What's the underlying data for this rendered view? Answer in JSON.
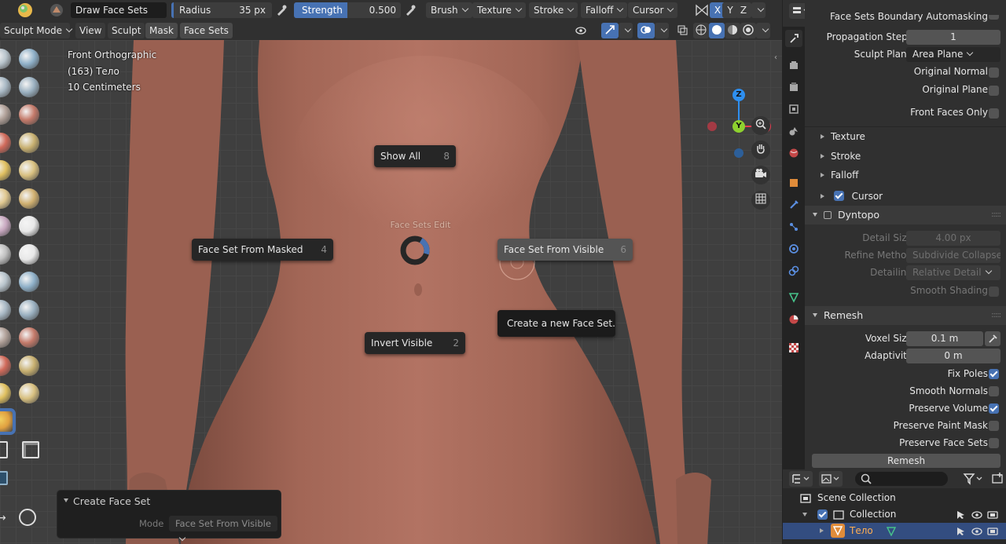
{
  "header": {
    "brush_name": "Draw Face Sets",
    "radius_label": "Radius",
    "radius_value": "35 px",
    "strength_label": "Strength",
    "strength_value": "0.500",
    "menus": [
      "Brush",
      "Texture",
      "Stroke",
      "Falloff",
      "Cursor"
    ],
    "symmetry_axes": [
      "X",
      "Y",
      "Z"
    ]
  },
  "mode_bar": {
    "mode": "Sculpt Mode",
    "menus": [
      "View",
      "Sculpt",
      "Mask",
      "Face Sets"
    ]
  },
  "viewport": {
    "view_name": "Front Orthographic",
    "object_info": "(163) Тело",
    "scale_info": "10 Centimeters",
    "gizmo_axes": [
      "Z",
      "Y",
      "X"
    ]
  },
  "pie_menu": {
    "title": "Face Sets Edit",
    "items": [
      {
        "label": "Show All",
        "key": "8"
      },
      {
        "label": "Face Set From Masked",
        "key": "4"
      },
      {
        "label": "Face Set From Visible",
        "key": "6"
      },
      {
        "label": "Invert Visible",
        "key": "2"
      }
    ],
    "tooltip": "Create a new Face Set."
  },
  "operator_panel": {
    "title": "Create Face Set",
    "mode_label": "Mode",
    "mode_value": "Face Set From Visible"
  },
  "properties": {
    "top_cut_label": "Face Sets Boundary Automasking",
    "propagation_steps_label": "Propagation Steps",
    "propagation_steps_value": "1",
    "sculpt_plane_label": "Sculpt Plane",
    "sculpt_plane_value": "Area Plane",
    "original_normal_label": "Original Normal",
    "original_plane_label": "Original Plane",
    "front_faces_only_label": "Front Faces Only",
    "subpanels": [
      "Texture",
      "Stroke",
      "Falloff",
      "Cursor"
    ],
    "dyntopo": {
      "title": "Dyntopo",
      "detail_size_label": "Detail Size",
      "detail_size_value": "4.00 px",
      "refine_method_label": "Refine Method",
      "refine_method_value": "Subdivide Collapse",
      "detailing_label": "Detailing",
      "detailing_value": "Relative Detail",
      "smooth_shading_label": "Smooth Shading"
    },
    "remesh": {
      "title": "Remesh",
      "voxel_size_label": "Voxel Size",
      "voxel_size_value": "0.1 m",
      "adaptivity_label": "Adaptivity",
      "adaptivity_value": "0 m",
      "fix_poles_label": "Fix Poles",
      "smooth_normals_label": "Smooth Normals",
      "preserve_volume_label": "Preserve Volume",
      "preserve_paint_mask_label": "Preserve Paint Mask",
      "preserve_face_sets_label": "Preserve Face Sets",
      "button_label": "Remesh"
    }
  },
  "outliner": {
    "scene_collection": "Scene Collection",
    "collection": "Collection",
    "object": "Тело"
  },
  "colors": {
    "accent": "#4772b3",
    "skin": "#a86a5a",
    "axis_x": "#e53d4f",
    "axis_y": "#8ed12f",
    "axis_z": "#2e8ff0"
  }
}
